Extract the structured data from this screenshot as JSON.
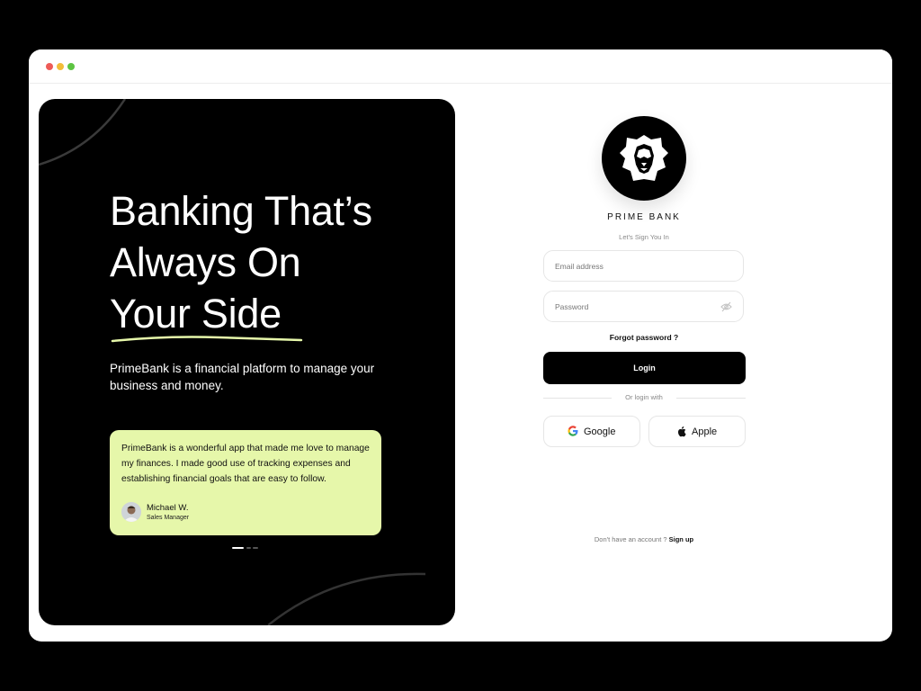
{
  "hero": {
    "headline_line1": "Banking That’s",
    "headline_line2": "Always On",
    "headline_line3": "Your Side",
    "subtext": "PrimeBank is a financial platform to manage your business and money.",
    "testimonial": {
      "quote": "PrimeBank is a wonderful app that made me love to manage my finances. I made good use of tracking expenses and establishing financial goals that are easy to follow.",
      "author_name": "Michael W.",
      "author_role": "Sales Manager"
    },
    "accent_color": "#e6f7aa"
  },
  "login": {
    "brand_name": "PRIME BANK",
    "subtitle": "Let's Sign You In",
    "email_placeholder": "Email address",
    "password_placeholder": "Password",
    "forgot_password": "Forgot password ?",
    "login_label": "Login",
    "divider_text": "Or login with",
    "google_label": "Google",
    "apple_label": "Apple",
    "no_account_text": "Don't have an account ?",
    "signup_label": "Sign up"
  },
  "icons": {
    "logo": "lion-icon",
    "password_toggle": "eye-off-icon",
    "google": "google-icon",
    "apple": "apple-icon"
  }
}
